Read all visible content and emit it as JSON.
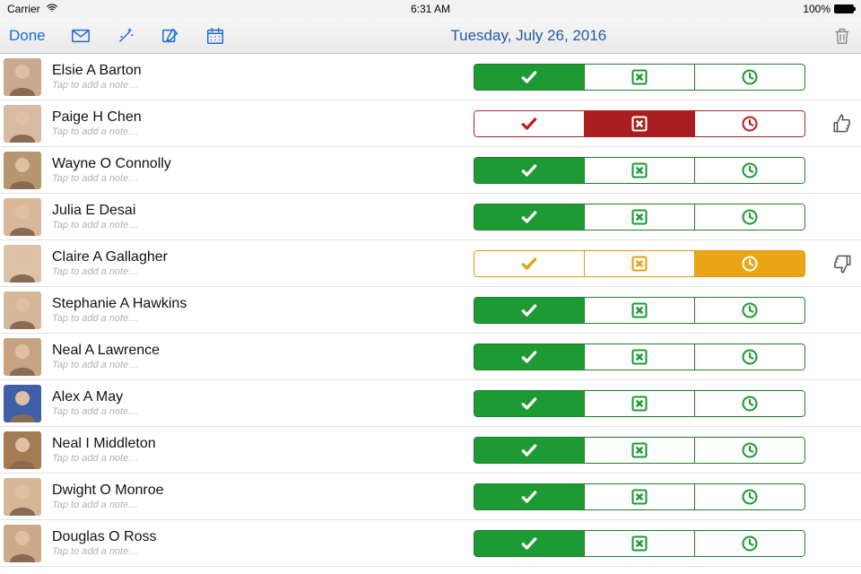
{
  "status": {
    "carrier": "Carrier",
    "time": "6:31 AM",
    "battery": "100%"
  },
  "toolbar": {
    "done": "Done",
    "date": "Tuesday, July 26, 2016"
  },
  "placeholder_note": "Tap to add a note…",
  "rows": [
    {
      "name": "Elsie A Barton",
      "scheme": "green",
      "selected": 0,
      "trailing": null,
      "avatar": "#c9a98f"
    },
    {
      "name": "Paige H Chen",
      "scheme": "red",
      "selected": 1,
      "trailing": "thumbs-up",
      "avatar": "#d8b9a1"
    },
    {
      "name": "Wayne O Connolly",
      "scheme": "green",
      "selected": 0,
      "trailing": null,
      "avatar": "#b7966f"
    },
    {
      "name": "Julia E Desai",
      "scheme": "green",
      "selected": 0,
      "trailing": null,
      "avatar": "#d9b79a"
    },
    {
      "name": "Claire A Gallagher",
      "scheme": "orange",
      "selected": 2,
      "trailing": "thumbs-down",
      "avatar": "#dcc1ab"
    },
    {
      "name": "Stephanie A Hawkins",
      "scheme": "green",
      "selected": 0,
      "trailing": null,
      "avatar": "#d6b699"
    },
    {
      "name": "Neal A Lawrence",
      "scheme": "green",
      "selected": 0,
      "trailing": null,
      "avatar": "#c8a381"
    },
    {
      "name": "Alex A May",
      "scheme": "green",
      "selected": 0,
      "trailing": null,
      "avatar": "#3f5fa8"
    },
    {
      "name": "Neal I Middleton",
      "scheme": "green",
      "selected": 0,
      "trailing": null,
      "avatar": "#a57b52"
    },
    {
      "name": "Dwight O Monroe",
      "scheme": "green",
      "selected": 0,
      "trailing": null,
      "avatar": "#d7b698"
    },
    {
      "name": "Douglas O Ross",
      "scheme": "green",
      "selected": 0,
      "trailing": null,
      "avatar": "#cca98a"
    }
  ]
}
